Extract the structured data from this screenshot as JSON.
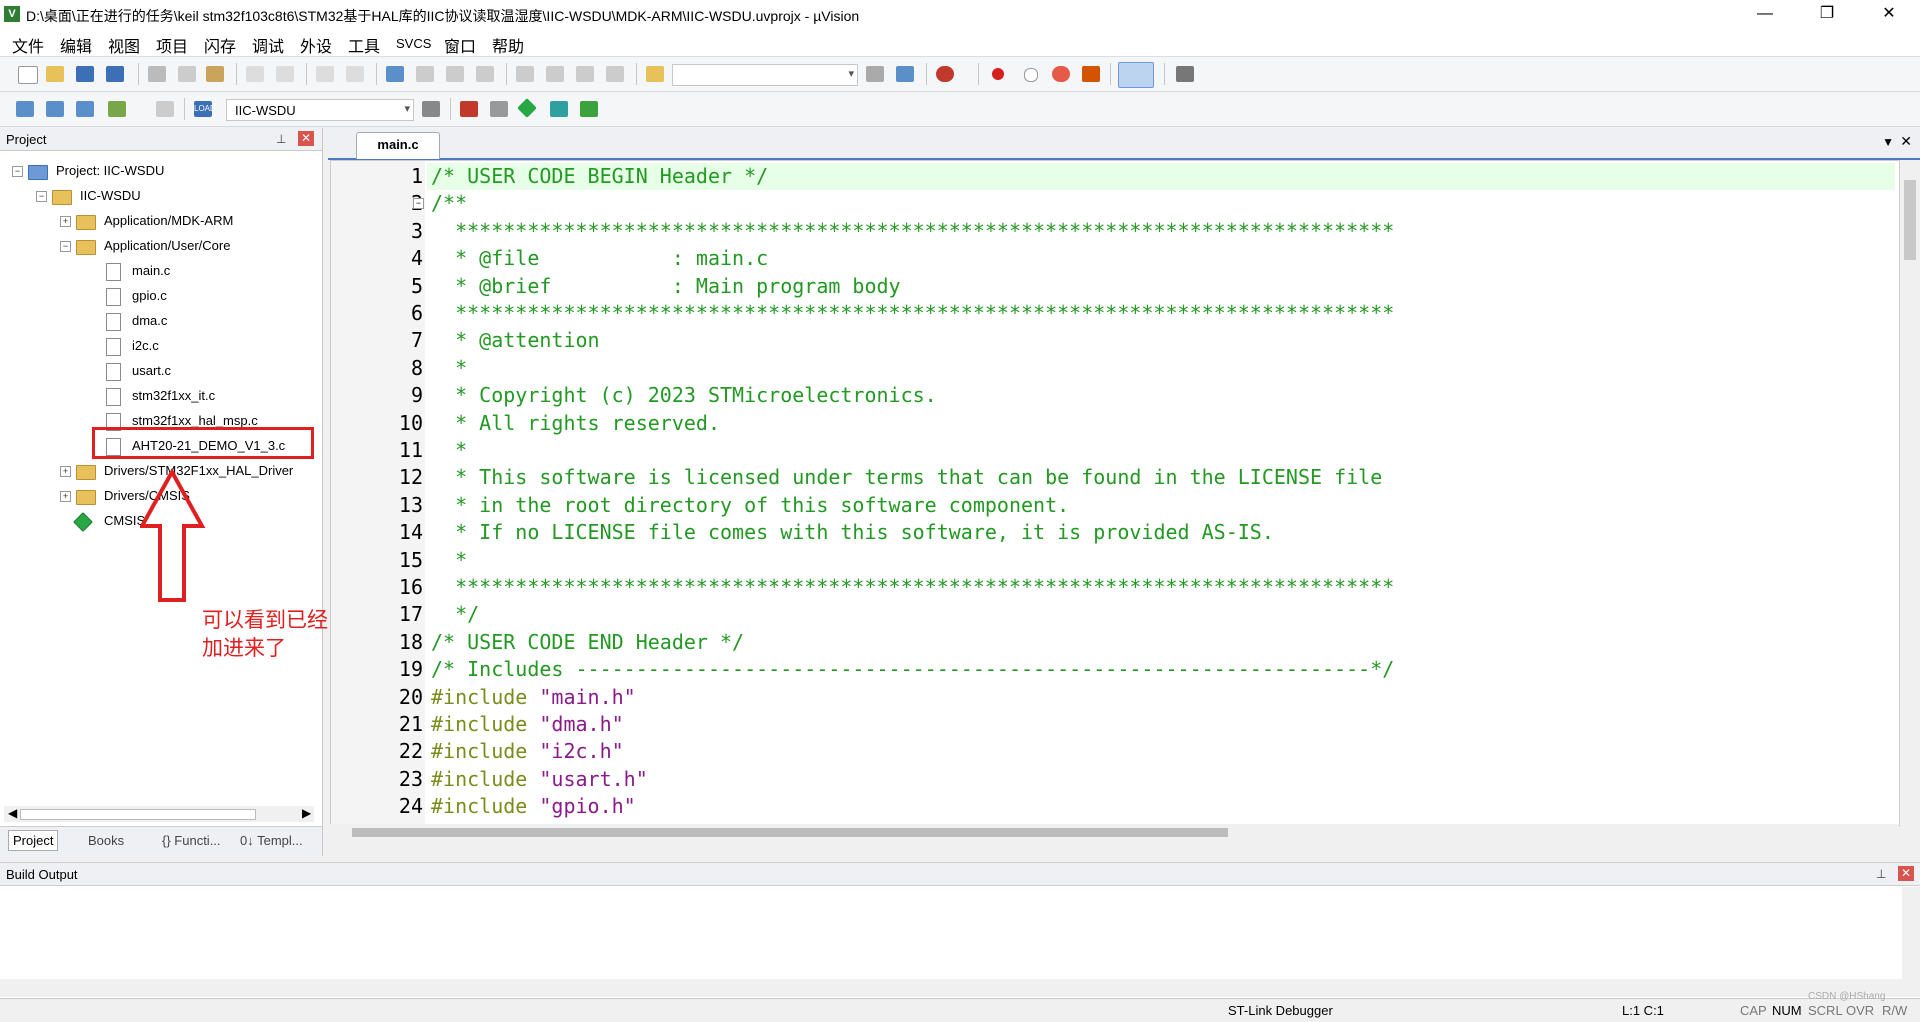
{
  "window": {
    "title": "D:\\桌面\\正在进行的任务\\keil stm32f103c8t6\\STM32基于HAL库的IIC协议读取温湿度\\IIC-WSDU\\MDK-ARM\\IIC-WSDU.uvprojx - µVision",
    "minimize": "—",
    "restore": "❐",
    "close": "✕"
  },
  "menu": [
    "文件",
    "编辑",
    "视图",
    "项目",
    "闪存",
    "调试",
    "外设",
    "工具",
    "SVCS",
    "窗口",
    "帮助"
  ],
  "toolbar2": {
    "target_select": "IIC-WSDU",
    "load_label": "LOAD"
  },
  "project_panel": {
    "title": "Project",
    "pin": "📌",
    "close": "✕",
    "tree": [
      {
        "label": "Project: IIC-WSDU",
        "level": 0,
        "type": "project",
        "expanded": true
      },
      {
        "label": "IIC-WSDU",
        "level": 1,
        "type": "target",
        "expanded": true
      },
      {
        "label": "Application/MDK-ARM",
        "level": 2,
        "type": "folder",
        "expanded": false
      },
      {
        "label": "Application/User/Core",
        "level": 2,
        "type": "folder",
        "expanded": true
      },
      {
        "label": "main.c",
        "level": 3,
        "type": "file"
      },
      {
        "label": "gpio.c",
        "level": 3,
        "type": "file"
      },
      {
        "label": "dma.c",
        "level": 3,
        "type": "file"
      },
      {
        "label": "i2c.c",
        "level": 3,
        "type": "file"
      },
      {
        "label": "usart.c",
        "level": 3,
        "type": "file"
      },
      {
        "label": "stm32f1xx_it.c",
        "level": 3,
        "type": "file"
      },
      {
        "label": "stm32f1xx_hal_msp.c",
        "level": 3,
        "type": "file"
      },
      {
        "label": "AHT20-21_DEMO_V1_3.c",
        "level": 3,
        "type": "file"
      },
      {
        "label": "Drivers/STM32F1xx_HAL_Driver",
        "level": 2,
        "type": "folder",
        "expanded": false
      },
      {
        "label": "Drivers/CMSIS",
        "level": 2,
        "type": "folder",
        "expanded": false
      },
      {
        "label": "CMSIS",
        "level": 2,
        "type": "component"
      }
    ],
    "bottom_tabs": [
      "Project",
      "Books",
      "{} Functi...",
      "0↓ Templ..."
    ]
  },
  "annotation": {
    "text": "可以看到已经成功添加进来了"
  },
  "editor": {
    "tab": "main.c",
    "lines": [
      {
        "n": "1",
        "parts": [
          {
            "t": "/* USER CODE BEGIN Header */",
            "c": "comment"
          }
        ],
        "hl": true
      },
      {
        "n": "2",
        "parts": [
          {
            "t": "/**",
            "c": "comment"
          }
        ]
      },
      {
        "n": "3",
        "parts": [
          {
            "t": "  ******************************************************************************",
            "c": "comment"
          }
        ]
      },
      {
        "n": "4",
        "parts": [
          {
            "t": "  * @file           : main.c",
            "c": "comment"
          }
        ]
      },
      {
        "n": "5",
        "parts": [
          {
            "t": "  * @brief          : Main program body",
            "c": "comment"
          }
        ]
      },
      {
        "n": "6",
        "parts": [
          {
            "t": "  ******************************************************************************",
            "c": "comment"
          }
        ]
      },
      {
        "n": "7",
        "parts": [
          {
            "t": "  * @attention",
            "c": "comment"
          }
        ]
      },
      {
        "n": "8",
        "parts": [
          {
            "t": "  *",
            "c": "comment"
          }
        ]
      },
      {
        "n": "9",
        "parts": [
          {
            "t": "  * Copyright (c) 2023 STMicroelectronics.",
            "c": "comment"
          }
        ]
      },
      {
        "n": "10",
        "parts": [
          {
            "t": "  * All rights reserved.",
            "c": "comment"
          }
        ]
      },
      {
        "n": "11",
        "parts": [
          {
            "t": "  *",
            "c": "comment"
          }
        ]
      },
      {
        "n": "12",
        "parts": [
          {
            "t": "  * This software is licensed under terms that can be found in the LICENSE file",
            "c": "comment"
          }
        ]
      },
      {
        "n": "13",
        "parts": [
          {
            "t": "  * in the root directory of this software component.",
            "c": "comment"
          }
        ]
      },
      {
        "n": "14",
        "parts": [
          {
            "t": "  * If no LICENSE file comes with this software, it is provided AS-IS.",
            "c": "comment"
          }
        ]
      },
      {
        "n": "15",
        "parts": [
          {
            "t": "  *",
            "c": "comment"
          }
        ]
      },
      {
        "n": "16",
        "parts": [
          {
            "t": "  ******************************************************************************",
            "c": "comment"
          }
        ]
      },
      {
        "n": "17",
        "parts": [
          {
            "t": "  */",
            "c": "comment"
          }
        ]
      },
      {
        "n": "18",
        "parts": [
          {
            "t": "/* USER CODE END Header */",
            "c": "comment"
          }
        ]
      },
      {
        "n": "19",
        "parts": [
          {
            "t": "/* Includes ------------------------------------------------------------------*/",
            "c": "comment"
          }
        ]
      },
      {
        "n": "20",
        "parts": [
          {
            "t": "#include ",
            "c": "kw"
          },
          {
            "t": "\"main.h\"",
            "c": "str"
          }
        ]
      },
      {
        "n": "21",
        "parts": [
          {
            "t": "#include ",
            "c": "kw"
          },
          {
            "t": "\"dma.h\"",
            "c": "str"
          }
        ]
      },
      {
        "n": "22",
        "parts": [
          {
            "t": "#include ",
            "c": "kw"
          },
          {
            "t": "\"i2c.h\"",
            "c": "str"
          }
        ]
      },
      {
        "n": "23",
        "parts": [
          {
            "t": "#include ",
            "c": "kw"
          },
          {
            "t": "\"usart.h\"",
            "c": "str"
          }
        ]
      },
      {
        "n": "24",
        "parts": [
          {
            "t": "#include ",
            "c": "kw"
          },
          {
            "t": "\"gpio.h\"",
            "c": "str"
          }
        ]
      }
    ]
  },
  "build_output": {
    "title": "Build Output",
    "pin": "📌",
    "close": "✕"
  },
  "status": {
    "debugger": "ST-Link Debugger",
    "position": "L:1 C:1",
    "cap": "CAP",
    "num": "NUM",
    "scrl": "SCRL",
    "ovr": "OVR",
    "rw": "R/W",
    "watermark": "CSDN @HShang"
  },
  "colors": {
    "comment": "#229922",
    "keyword": "#7a8c1a",
    "string": "#8a1a8a",
    "annotation_red": "#e02020",
    "line1_highlight": "#e6ffe6"
  }
}
